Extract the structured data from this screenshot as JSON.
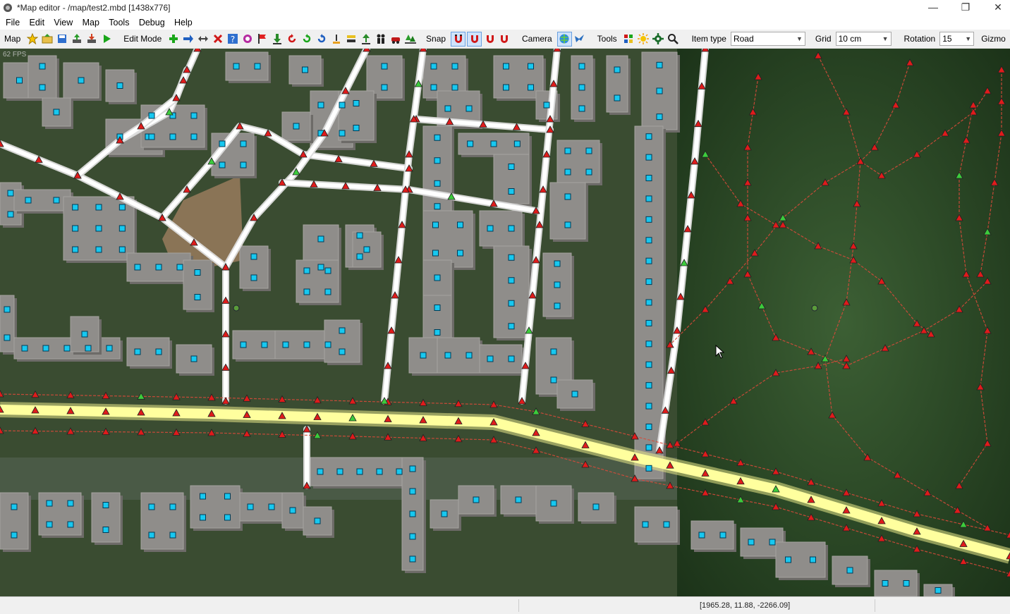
{
  "window": {
    "title": "*Map editor - /map/test2.mbd [1438x776]"
  },
  "menu": [
    "File",
    "Edit",
    "View",
    "Map",
    "Tools",
    "Debug",
    "Help"
  ],
  "toolbar": {
    "map_label": "Map",
    "edit_mode_label": "Edit Mode",
    "snap_label": "Snap",
    "camera_label": "Camera",
    "tools_label": "Tools",
    "item_type_label": "Item type",
    "item_type_value": "Road",
    "grid_label": "Grid",
    "grid_value": "10 cm",
    "rotation_label": "Rotation",
    "rotation_value": "15",
    "gizmo_label": "Gizmo"
  },
  "viewport": {
    "fps": "62 FPS"
  },
  "status": {
    "coords": "[1965.28, 11.88, -2266.09]"
  },
  "colors": {
    "road": "#ffffff",
    "main_road": "#ffff9e",
    "node_red": "#e01b1b",
    "node_green": "#3ccc3c",
    "marker_cyan": "#17c8f0"
  }
}
